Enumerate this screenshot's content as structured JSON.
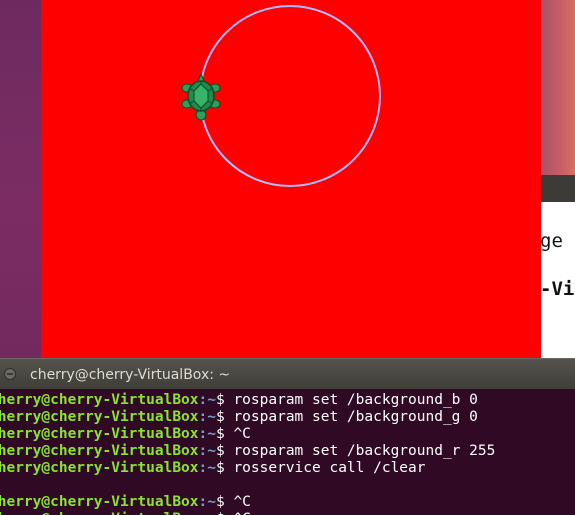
{
  "back_terminal": {
    "line1": "ge",
    "line2": "-Vi"
  },
  "turtlesim": {
    "background_color": "#ff0000",
    "path_color": "#b3b8ff",
    "turtle_icon": "turtle-icon"
  },
  "terminal": {
    "title": "cherry@cherry-VirtualBox: ~",
    "lines": [
      {
        "user": "cherry@cherry-VirtualBox",
        "path": ":~",
        "cmd": "$ rosparam set /background_b 0"
      },
      {
        "user": "cherry@cherry-VirtualBox",
        "path": ":~",
        "cmd": "$ rosparam set /background_g 0"
      },
      {
        "user": "cherry@cherry-VirtualBox",
        "path": ":~",
        "cmd": "$ ^C"
      },
      {
        "user": "cherry@cherry-VirtualBox",
        "path": ":~",
        "cmd": "$ rosparam set /background_r 255"
      },
      {
        "user": "cherry@cherry-VirtualBox",
        "path": ":~",
        "cmd": "$ rosservice call /clear"
      },
      {
        "user": "",
        "path": "",
        "cmd": ""
      },
      {
        "user": "cherry@cherry-VirtualBox",
        "path": ":~",
        "cmd": "$ ^C"
      },
      {
        "user": "cherry@cherry-VirtualBox",
        "path": ":~",
        "cmd": "$ ^C"
      }
    ]
  }
}
